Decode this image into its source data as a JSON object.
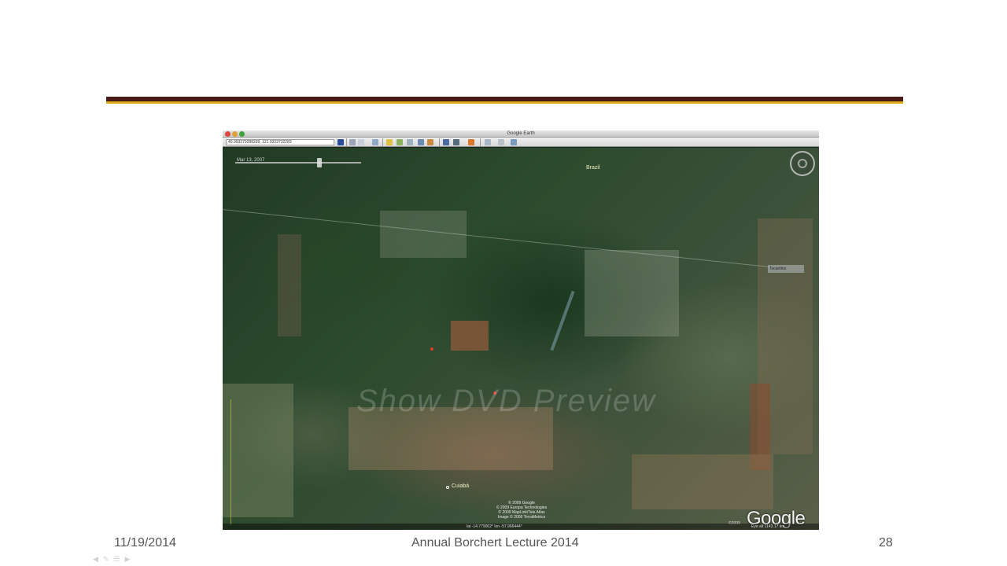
{
  "colors": {
    "rule_dark": "#4a1a18",
    "rule_gold": "#e0b020",
    "footer_text": "#555555"
  },
  "google_earth": {
    "window_title": "Google Earth",
    "coordinates": "40.993279288239, 121.9323732283",
    "toolbar_icons": [
      "sidebar-icon",
      "search-icon",
      "placemark-icon",
      "polygon-icon",
      "path-icon",
      "overlay-icon",
      "tour-icon",
      "history-icon",
      "sun-icon",
      "sky-icon",
      "ruler-icon",
      "email-icon",
      "print-icon",
      "map-view-icon"
    ],
    "map": {
      "date_label": "Mar 13, 2007",
      "places": {
        "brazil": "Brazil",
        "cuiaba": "Cuiabá",
        "box_label": "Tocantins"
      },
      "copyright_lines": [
        "© 2009 Google",
        "© 2009 Europa Technologies",
        "© 2009 MapLink/Tele Atlas",
        "Image © 2009 TerraMetrics"
      ],
      "pointer_readout": "lat -14.779002° lon -57.966444°",
      "eye_altitude": "Eye alt 1143.17 km",
      "logo_text": "Google",
      "logo_year": "©2009",
      "watermark_text": "Show DVD Preview"
    }
  },
  "footer": {
    "date": "11/19/2014",
    "title": "Annual Borchert Lecture 2014",
    "page_number": "28"
  }
}
